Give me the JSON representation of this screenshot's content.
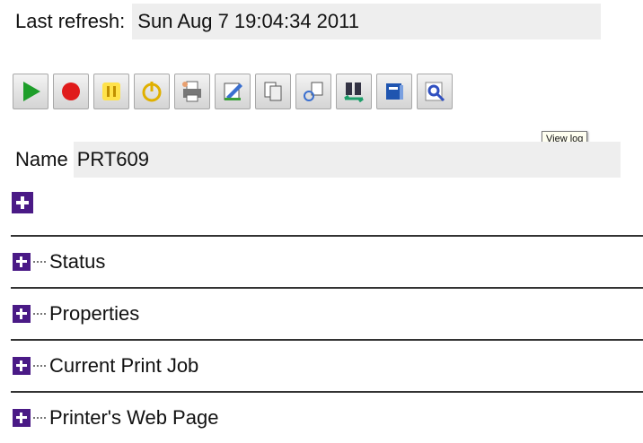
{
  "refresh": {
    "label": "Last refresh:",
    "value": "Sun Aug 7 19:04:34 2011"
  },
  "toolbar": {
    "buttons": [
      {
        "icon": "play-icon",
        "color": "#1e9e2a"
      },
      {
        "icon": "record-stop-icon",
        "color": "#e01b1b"
      },
      {
        "icon": "pause-icon",
        "color": "#e0c400"
      },
      {
        "icon": "power-icon",
        "color": "#e0b000"
      },
      {
        "icon": "printer-icon",
        "color": "#555555"
      },
      {
        "icon": "edit-properties-icon",
        "color": "#3a6fcf"
      },
      {
        "icon": "copy-icon",
        "color": "#555555"
      },
      {
        "icon": "connect-icon",
        "color": "#3a6fcf"
      },
      {
        "icon": "transfer-icon",
        "color": "#1e9e6a"
      },
      {
        "icon": "book-icon",
        "color": "#1f55b0"
      },
      {
        "icon": "view-log-icon",
        "color": "#3050c0"
      }
    ]
  },
  "tooltip": {
    "text": "View log"
  },
  "name": {
    "label": "Name",
    "value": "PRT609"
  },
  "sections": [
    {
      "label": "Status"
    },
    {
      "label": "Properties"
    },
    {
      "label": "Current Print Job"
    },
    {
      "label": "Printer's Web Page"
    }
  ],
  "colors": {
    "expander": "#4a1a86",
    "field_bg": "#eeeeee"
  }
}
